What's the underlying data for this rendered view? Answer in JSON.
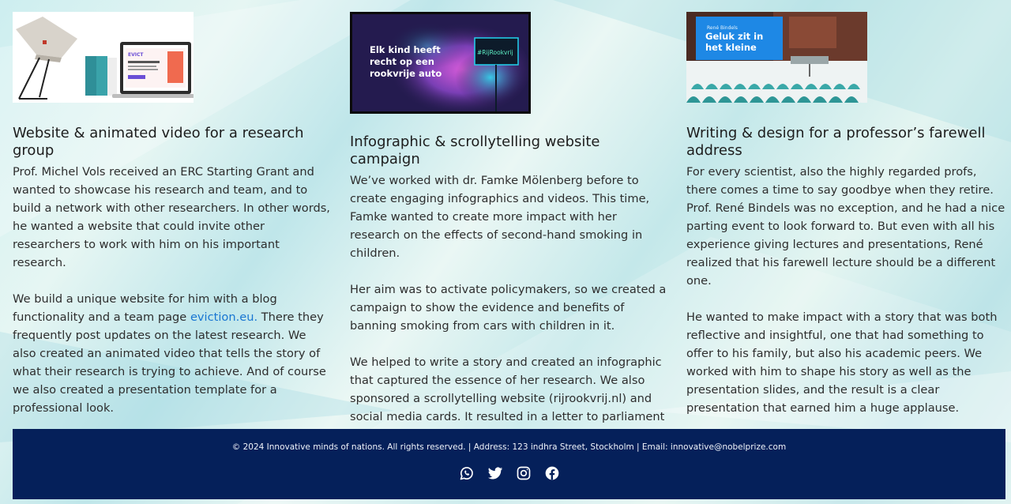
{
  "projects": [
    {
      "title": "Website & animated video for a research group",
      "paragraphs": [
        "Prof. Michel Vols received an ERC Starting Grant and wanted to showcase his research and team, and to build a network with other researchers. In other words, he wanted a website that could invite other researchers to work with him on his important research.",
        "We build a unique website for him with a blog functionality and a team page ",
        " There they frequently post updates on the latest research. We also created an animated video that tells the story of what their research is trying to achieve. And of course we also created a presentation template for a professional look."
      ],
      "link_text": "eviction.eu.",
      "thumb_text": "EVICT"
    },
    {
      "title": "Infographic & scrollytelling website campaign",
      "paragraphs": [
        "We’ve worked with dr. Famke Mölenberg before to create engaging infographics and videos. This time, Famke wanted to create more impact with her research on the effects of second-hand smoking in children.",
        "Her aim was to activate policymakers, so we created a campaign to show the evidence and benefits of banning smoking from cars with children in it.",
        "We helped to write a story and created an infographic that captured the essence of her research. We also sponsored a scrollytelling website (rijrookvrij.nl) and social media cards. It resulted in a letter to parliament and ongoing efforts to make this legislation possible."
      ],
      "thumb_text": "Elk kind heeft recht op een rookvrije auto",
      "thumb_tag": "#RijRookvrij"
    },
    {
      "title": "Writing & design for a professor’s farewell address",
      "paragraphs": [
        "For every scientist, also the highly regarded profs, there comes a time to say goodbye when they retire. Prof. René Bindels was no exception, and he had a nice parting event to look forward to. But even with all his experience giving lectures and presentations, René realized that his farewell lecture should be a different one.",
        "He wanted to make impact with a story that was both reflective and insightful, one that had something to offer to his family, but also his academic peers. We worked with him to shape his story as well as the presentation slides, and the result is a clear presentation that earned him a huge applause."
      ],
      "thumb_small": "René Bindels",
      "thumb_text": "Geluk zit in het kleine"
    }
  ],
  "footer": {
    "text": "© 2024 Innovative minds of nations. All rights reserved. | Address: 123 indhra Street, Stockholm | Email: innovative@nobelprize.com",
    "social_icons": [
      "whatsapp-icon",
      "twitter-icon",
      "instagram-icon",
      "facebook-icon"
    ]
  },
  "colors": {
    "footer_bg": "#05205a",
    "link": "#1976d2",
    "thumb2_bg": "#1f1846",
    "thumb3_blue": "#1e88e5",
    "thumb3_seats": "#3aa8a8"
  }
}
